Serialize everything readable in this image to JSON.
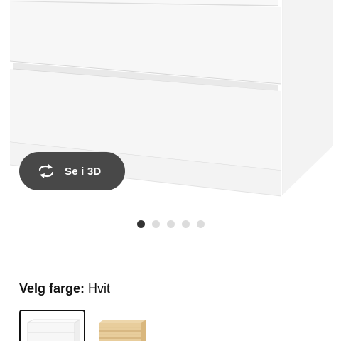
{
  "gallery": {
    "view_3d_label": "Se i 3D",
    "view_3d_icon": "rotate-3d-icon",
    "pagination": {
      "total": 5,
      "active": 0
    }
  },
  "color_picker": {
    "label": "Velg farge:",
    "value": "Hvit",
    "options": [
      {
        "name": "white",
        "color": "#ffffff",
        "selected": true
      },
      {
        "name": "oak-veneer",
        "color": "#e2c48f",
        "selected": false
      }
    ]
  },
  "colors": {
    "button_bg": "#484848",
    "dot_active": "#333333",
    "dot_inactive": "#dcdcdc"
  }
}
